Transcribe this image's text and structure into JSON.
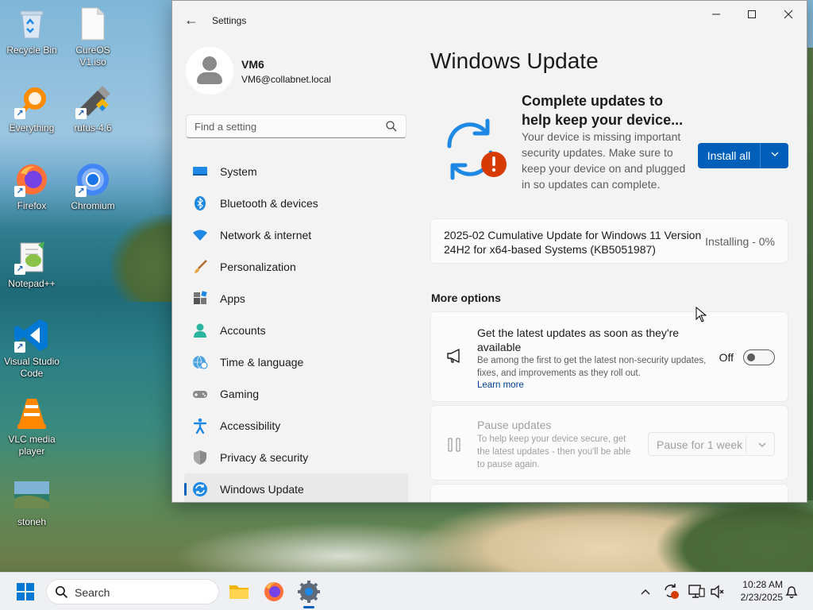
{
  "desktop": {
    "icons": [
      {
        "label": "Recycle Bin",
        "icon": "recycle-bin-icon"
      },
      {
        "label": "CureOS V1.iso",
        "icon": "iso-file-icon"
      },
      {
        "label": "Everything",
        "icon": "everything-search-icon"
      },
      {
        "label": "rufus-4.6",
        "icon": "rufus-usb-icon"
      },
      {
        "label": "Firefox",
        "icon": "firefox-icon"
      },
      {
        "label": "Chromium",
        "icon": "chromium-icon"
      },
      {
        "label": "Notepad++",
        "icon": "notepadpp-icon"
      },
      {
        "label": "Visual Studio Code",
        "icon": "vscode-icon"
      },
      {
        "label": "VLC media player",
        "icon": "vlc-icon"
      },
      {
        "label": "stoneh",
        "icon": "image-file-icon"
      }
    ]
  },
  "window": {
    "title": "Settings",
    "controls": {
      "minimize": "—",
      "maximize": "☐",
      "close": "✕"
    }
  },
  "profile": {
    "name": "VM6",
    "email": "VM6@collabnet.local"
  },
  "search": {
    "placeholder": "Find a setting"
  },
  "nav": {
    "items": [
      {
        "label": "System",
        "icon": "system-icon"
      },
      {
        "label": "Bluetooth & devices",
        "icon": "bluetooth-icon"
      },
      {
        "label": "Network & internet",
        "icon": "wifi-icon"
      },
      {
        "label": "Personalization",
        "icon": "brush-icon"
      },
      {
        "label": "Apps",
        "icon": "apps-icon"
      },
      {
        "label": "Accounts",
        "icon": "accounts-icon"
      },
      {
        "label": "Time & language",
        "icon": "globe-clock-icon"
      },
      {
        "label": "Gaming",
        "icon": "gamepad-icon"
      },
      {
        "label": "Accessibility",
        "icon": "accessibility-icon"
      },
      {
        "label": "Privacy & security",
        "icon": "shield-icon"
      },
      {
        "label": "Windows Update",
        "icon": "windows-update-icon",
        "active": true
      }
    ]
  },
  "main": {
    "title": "Windows Update",
    "hero": {
      "heading": "Complete updates to help keep your device...",
      "description": "Your device is missing important security updates. Make sure to keep your device on and plugged in so updates can complete.",
      "button": "Install all"
    },
    "update": {
      "name": "2025-02 Cumulative Update for Windows 11 Version 24H2 for x64-based Systems (KB5051987)",
      "status": "Installing - 0%"
    },
    "more_options": {
      "heading": "More options",
      "latest": {
        "title": "Get the latest updates as soon as they're available",
        "description": "Be among the first to get the latest non-security updates, fixes, and improvements as they roll out.",
        "link": "Learn more",
        "toggle_label": "Off",
        "toggle_on": false
      },
      "pause": {
        "title": "Pause updates",
        "description": "To help keep your device secure, get the latest updates - then you'll be able to pause again.",
        "dropdown": "Pause for 1 week"
      }
    }
  },
  "taskbar": {
    "search_label": "Search",
    "apps": [
      "file-explorer-icon",
      "firefox-icon",
      "settings-gear-icon"
    ],
    "clock": {
      "time": "10:28 AM",
      "date": "2/23/2025"
    }
  },
  "colors": {
    "accent": "#005fb8",
    "alert": "#d83b01"
  }
}
